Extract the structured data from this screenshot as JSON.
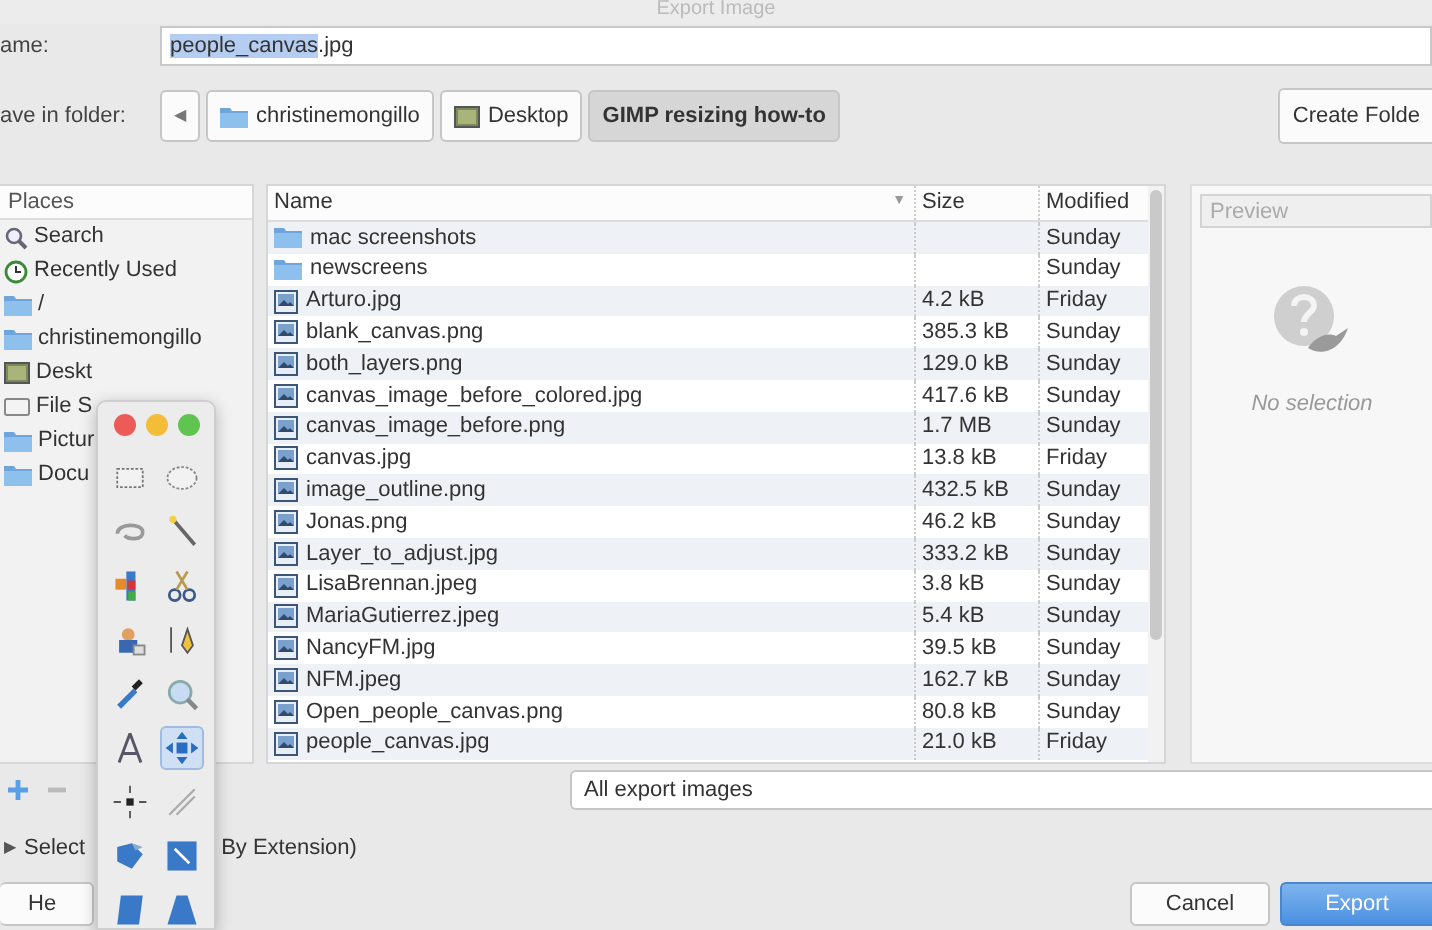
{
  "window": {
    "title": "Export Image"
  },
  "name_field": {
    "label": "ame:",
    "value_selected": "people_canvas",
    "value_rest": ".jpg"
  },
  "save_in": {
    "label": "ave in folder:",
    "back": "◀",
    "crumbs": [
      {
        "label": "christinemongillo",
        "kind": "folder",
        "selected": false
      },
      {
        "label": "Desktop",
        "kind": "desktop",
        "selected": false
      },
      {
        "label": "GIMP resizing how-to",
        "kind": "none",
        "selected": true
      }
    ],
    "create_folder": "Create Folde"
  },
  "places": {
    "header": "Places",
    "items": [
      {
        "label": "Search",
        "kind": "search"
      },
      {
        "label": "Recently Used",
        "kind": "recent"
      },
      {
        "label": "/",
        "kind": "folder"
      },
      {
        "label": "christinemongillo",
        "kind": "folder"
      },
      {
        "label": "Deskt",
        "kind": "desktop"
      },
      {
        "label": "File S",
        "kind": "drive"
      },
      {
        "label": "Pictur",
        "kind": "folder"
      },
      {
        "label": "Docu",
        "kind": "folder"
      }
    ]
  },
  "files": {
    "columns": [
      "Name",
      "Size",
      "Modified"
    ],
    "sort_arrow": "▼",
    "rows": [
      {
        "name": "mac screenshots",
        "size": "",
        "modified": "Sunday",
        "kind": "folder"
      },
      {
        "name": "newscreens",
        "size": "",
        "modified": "Sunday",
        "kind": "folder"
      },
      {
        "name": "Arturo.jpg",
        "size": "4.2 kB",
        "modified": "Friday",
        "kind": "image"
      },
      {
        "name": "blank_canvas.png",
        "size": "385.3 kB",
        "modified": "Sunday",
        "kind": "image"
      },
      {
        "name": "both_layers.png",
        "size": "129.0 kB",
        "modified": "Sunday",
        "kind": "image"
      },
      {
        "name": "canvas_image_before_colored.jpg",
        "size": "417.6 kB",
        "modified": "Sunday",
        "kind": "image"
      },
      {
        "name": "canvas_image_before.png",
        "size": "1.7 MB",
        "modified": "Sunday",
        "kind": "image"
      },
      {
        "name": "canvas.jpg",
        "size": "13.8 kB",
        "modified": "Friday",
        "kind": "image"
      },
      {
        "name": "image_outline.png",
        "size": "432.5 kB",
        "modified": "Sunday",
        "kind": "image"
      },
      {
        "name": "Jonas.png",
        "size": "46.2 kB",
        "modified": "Sunday",
        "kind": "image"
      },
      {
        "name": "Layer_to_adjust.jpg",
        "size": "333.2 kB",
        "modified": "Sunday",
        "kind": "image"
      },
      {
        "name": "LisaBrennan.jpeg",
        "size": "3.8 kB",
        "modified": "Sunday",
        "kind": "image"
      },
      {
        "name": "MariaGutierrez.jpeg",
        "size": "5.4 kB",
        "modified": "Sunday",
        "kind": "image"
      },
      {
        "name": "NancyFM.jpg",
        "size": "39.5 kB",
        "modified": "Sunday",
        "kind": "image"
      },
      {
        "name": "NFM.jpeg",
        "size": "162.7 kB",
        "modified": "Sunday",
        "kind": "image"
      },
      {
        "name": "Open_people_canvas.png",
        "size": "80.8 kB",
        "modified": "Sunday",
        "kind": "image"
      },
      {
        "name": "people_canvas.jpg",
        "size": "21.0 kB",
        "modified": "Friday",
        "kind": "image"
      }
    ]
  },
  "preview": {
    "header": "Preview",
    "message": "No selection"
  },
  "filter": {
    "value": "All export images"
  },
  "file_type_expander": {
    "arrow": "▶",
    "label_left": "Select",
    "label_right": "By Extension)"
  },
  "buttons": {
    "help": "He",
    "cancel": "Cancel",
    "export": "Export"
  },
  "toolbox": {
    "tools": [
      {
        "kind": "rectangle",
        "selected": false
      },
      {
        "kind": "ellipse",
        "selected": false
      },
      {
        "kind": "lasso",
        "selected": false
      },
      {
        "kind": "wand",
        "selected": false
      },
      {
        "kind": "bycolor",
        "selected": false
      },
      {
        "kind": "scissors",
        "selected": false
      },
      {
        "kind": "foreground",
        "selected": false
      },
      {
        "kind": "paths",
        "selected": false
      },
      {
        "kind": "picker",
        "selected": false
      },
      {
        "kind": "zoom",
        "selected": false
      },
      {
        "kind": "measure",
        "selected": false
      },
      {
        "kind": "move",
        "selected": true
      },
      {
        "kind": "align",
        "selected": false
      },
      {
        "kind": "knife",
        "selected": false
      },
      {
        "kind": "rotate",
        "selected": false
      },
      {
        "kind": "scale",
        "selected": false
      },
      {
        "kind": "shear",
        "selected": false
      },
      {
        "kind": "perspective",
        "selected": false
      }
    ]
  }
}
